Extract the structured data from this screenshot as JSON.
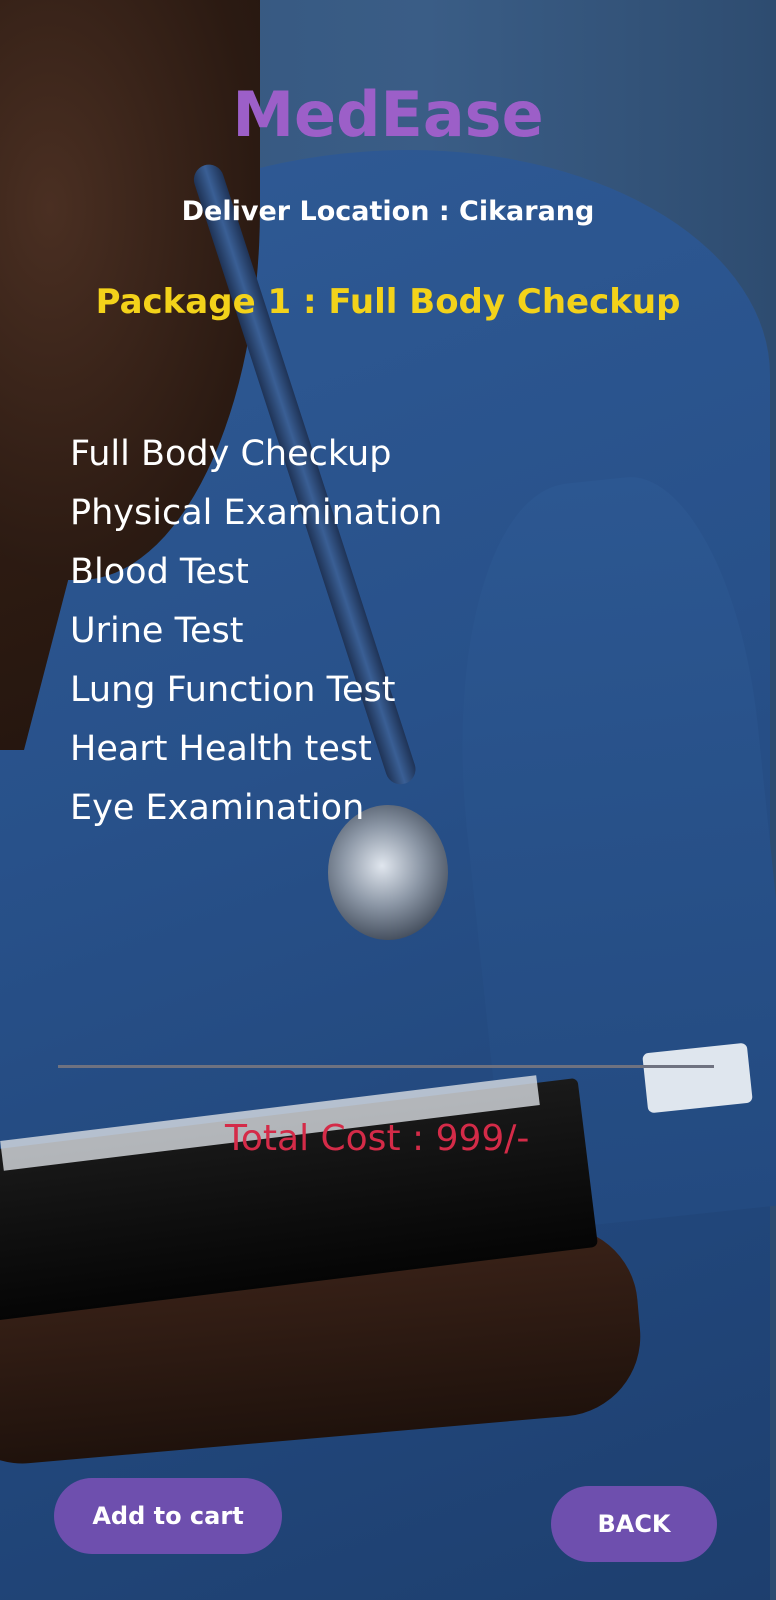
{
  "app": {
    "title": "MedEase"
  },
  "location": {
    "label": "Deliver Location : Cikarang"
  },
  "package": {
    "title": "Package 1 : Full Body Checkup"
  },
  "tests": [
    "Full Body Checkup",
    "Physical Examination",
    "Blood Test",
    "Urine Test",
    "Lung Function Test",
    "Heart Health test",
    "Eye Examination"
  ],
  "summary": {
    "total_cost": "Total Cost : 999/-"
  },
  "actions": {
    "add_to_cart_label": "Add to cart",
    "back_label": "BACK"
  },
  "colors": {
    "title": "#9c5fc8",
    "package": "#f3d21a",
    "total": "#d42b48",
    "button": "#6e4fae"
  }
}
